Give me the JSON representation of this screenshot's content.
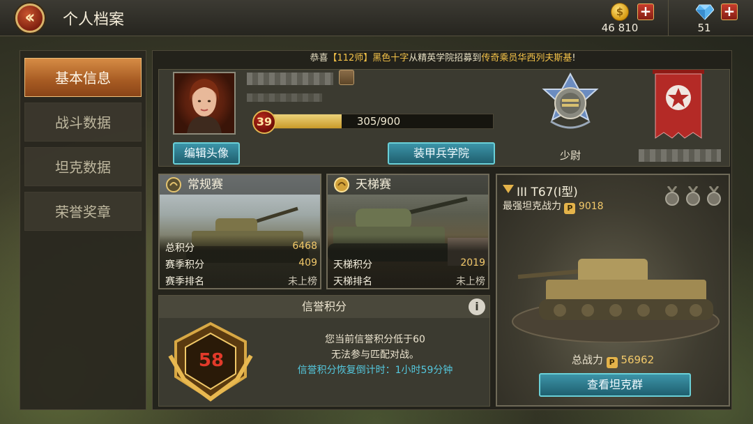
{
  "header": {
    "title": "个人档案",
    "gold": "46 810",
    "gems": "51"
  },
  "notice": {
    "prefix": "恭喜",
    "unit": "【112师】",
    "player": "黑色十字",
    "middle": "从精英学院招募到",
    "rarity": "传奇乘员",
    "crew": "华西列夫斯基",
    "suffix": "!"
  },
  "nav": {
    "items": [
      {
        "label": "基本信息",
        "active": true
      },
      {
        "label": "战斗数据",
        "active": false
      },
      {
        "label": "坦克数据",
        "active": false
      },
      {
        "label": "荣誉奖章",
        "active": false
      }
    ]
  },
  "profile": {
    "level": "39",
    "xp_text": "305/900",
    "xp_progress": 0.339,
    "edit_avatar": "编辑头像",
    "academy": "装甲兵学院",
    "rank": "少尉"
  },
  "regular": {
    "title": "常规赛",
    "rows": [
      {
        "label": "总积分",
        "value": "6468"
      },
      {
        "label": "赛季积分",
        "value": "409"
      },
      {
        "label": "赛季排名",
        "value": "未上榜"
      }
    ]
  },
  "ladder": {
    "title": "天梯赛",
    "rows": [
      {
        "label": "天梯积分",
        "value": "2019"
      },
      {
        "label": "天梯排名",
        "value": "未上榜"
      }
    ]
  },
  "credit": {
    "title": "信誉积分",
    "value": "58",
    "line1": "您当前信誉积分低于60",
    "line2": "无法参与匹配对战。",
    "line3": "信誉积分恢复倒计时：1小时59分钟"
  },
  "tank": {
    "name": "III T67(I型)",
    "power_label": "最强坦克战力",
    "power_value": "9018",
    "total_label": "总战力",
    "total_value": "56962",
    "view_button": "查看坦克群"
  },
  "colors": {
    "accent_gold": "#f2c96a",
    "accent_cyan": "#54c8de",
    "nav_active": "#c87636",
    "credit_red": "#e23a2a"
  }
}
